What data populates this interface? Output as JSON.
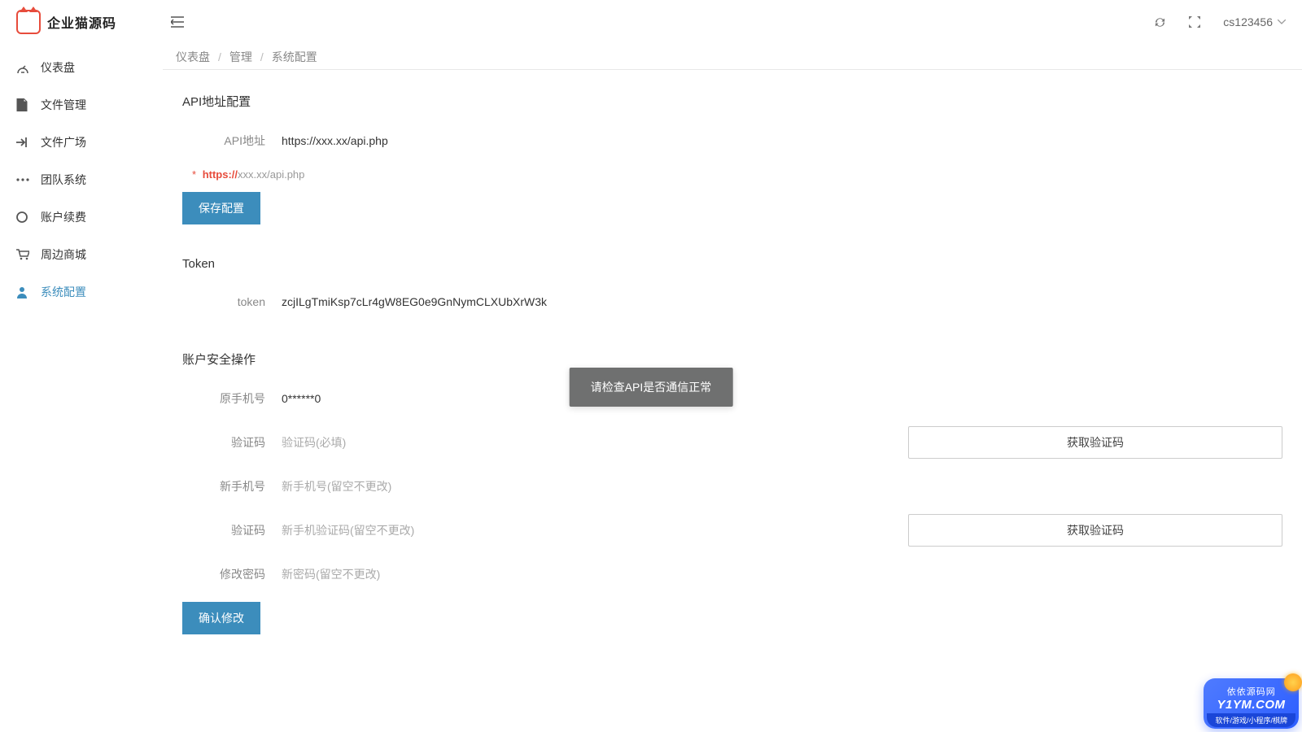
{
  "logo_text": "企业猫源码",
  "user_name": "cs123456",
  "sidebar": {
    "items": [
      {
        "label": "仪表盘",
        "icon": "dashboard"
      },
      {
        "label": "文件管理",
        "icon": "file"
      },
      {
        "label": "文件广场",
        "icon": "share"
      },
      {
        "label": "团队系统",
        "icon": "dots"
      },
      {
        "label": "账户续费",
        "icon": "circle"
      },
      {
        "label": "周边商城",
        "icon": "cart"
      },
      {
        "label": "系统配置",
        "icon": "user"
      }
    ],
    "active_index": 6
  },
  "breadcrumb": {
    "items": [
      "仪表盘",
      "管理",
      "系统配置"
    ]
  },
  "sections": {
    "api": {
      "title": "API地址配置",
      "label": "API地址",
      "value": "https://xxx.xx/api.php",
      "hint_star": "*",
      "hint_proto": "https://",
      "hint_rest": "xxx.xx/api.php",
      "save_btn": "保存配置"
    },
    "token": {
      "title": "Token",
      "label": "token",
      "value": "zcjILgTmiKsp7cLr4gW8EG0e9GnNymCLXUbXrW3k"
    },
    "security": {
      "title": "账户安全操作",
      "old_phone_label": "原手机号",
      "old_phone_value": "0******0",
      "code1_label": "验证码",
      "code1_placeholder": "验证码(必填)",
      "get_code_btn": "获取验证码",
      "new_phone_label": "新手机号",
      "new_phone_placeholder": "新手机号(留空不更改)",
      "code2_label": "验证码",
      "code2_placeholder": "新手机验证码(留空不更改)",
      "pwd_label": "修改密码",
      "pwd_placeholder": "新密码(留空不更改)",
      "submit_btn": "确认修改"
    }
  },
  "toast": "请检查API是否通信正常",
  "watermark": {
    "title": "依依源码网",
    "url": "Y1YM.COM",
    "sub": "软件/游戏/小程序/棋牌"
  }
}
